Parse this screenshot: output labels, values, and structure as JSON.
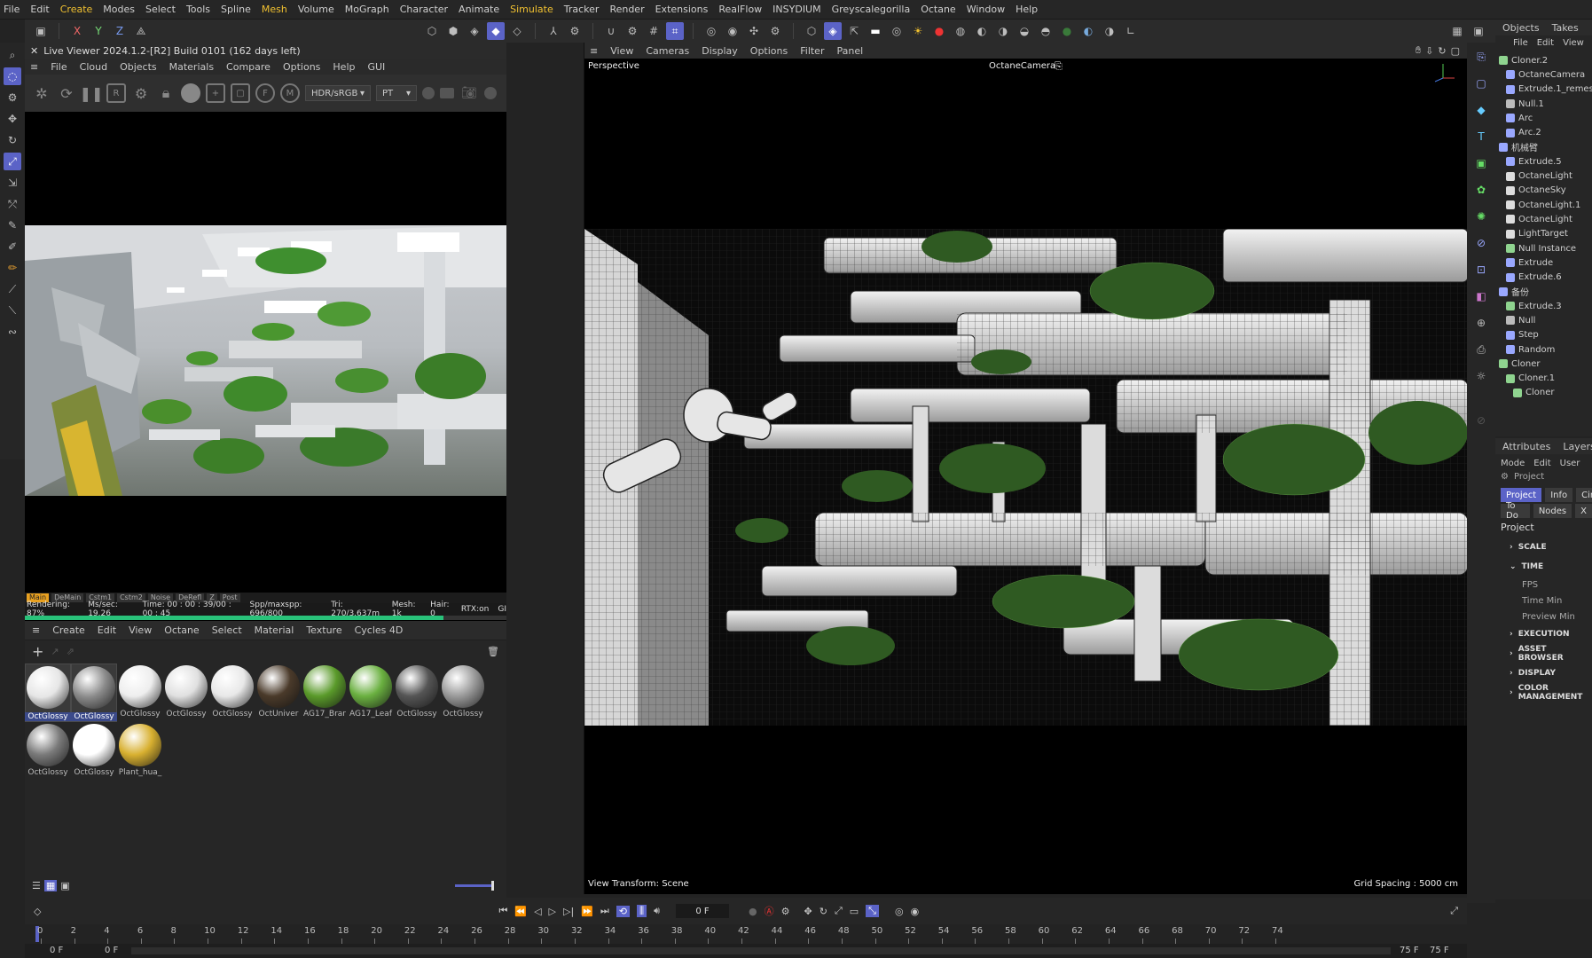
{
  "menubar": {
    "items": [
      "File",
      "Edit",
      "Create",
      "Modes",
      "Select",
      "Tools",
      "Spline",
      "Mesh",
      "Volume",
      "MoGraph",
      "Character",
      "Animate",
      "Simulate",
      "Tracker",
      "Render",
      "Extensions",
      "RealFlow",
      "INSYDIUM",
      "Greyscalegorilla",
      "Octane",
      "Window",
      "Help"
    ]
  },
  "toolbar": {
    "axes": [
      "X",
      "Y",
      "Z"
    ]
  },
  "live_viewer": {
    "title": "Live Viewer 2024.1.2-[R2] Build 0101 (162 days left)",
    "menu": [
      "File",
      "Cloud",
      "Objects",
      "Materials",
      "Compare",
      "Options",
      "Help",
      "GUI"
    ],
    "color_space": "HDR/sRGB",
    "kernel": "PT",
    "tabs": [
      "Main",
      "DeMain",
      "Cstm1",
      "Cstm2",
      "Noise",
      "DeRefl",
      "Z",
      "Post"
    ],
    "status": {
      "rendering": "Rendering: 87%",
      "mspersec": "Ms/sec: 19.26",
      "time": "Time: 00 : 00 : 39/00 : 00 : 45",
      "spp": "Spp/maxspp: 696/800",
      "tri": "Tri: 270/3.637m",
      "mesh": "Mesh: 1k",
      "hair": "Hair: 0",
      "rtx": "RTX:on",
      "gpu": "GI"
    },
    "progress": 0.87
  },
  "material_manager": {
    "menu": [
      "Create",
      "Edit",
      "View",
      "Octane",
      "Select",
      "Material",
      "Texture",
      "Cycles 4D"
    ],
    "materials": [
      {
        "name": "OctGlossy",
        "color": "#e6e6e6",
        "selected": true
      },
      {
        "name": "OctGlossy",
        "color": "#8a8a8a",
        "selected": true
      },
      {
        "name": "OctGlossy",
        "color": "#eeeeee",
        "selected": false
      },
      {
        "name": "OctGlossy",
        "color": "#e0e0e0",
        "selected": false
      },
      {
        "name": "OctGlossy",
        "color": "#e8e8e8",
        "selected": false
      },
      {
        "name": "OctUniver",
        "color": "#4a3a2a",
        "selected": false
      },
      {
        "name": "AG17_Brar",
        "color": "#5a9a2a",
        "selected": false
      },
      {
        "name": "AG17_Leaf",
        "color": "#6ab040",
        "selected": false
      },
      {
        "name": "OctGlossy",
        "color": "#555555",
        "selected": false
      },
      {
        "name": "OctGlossy",
        "color": "#9a9a9a",
        "selected": false
      },
      {
        "name": "OctGlossy",
        "color": "#7a7a7a",
        "selected": false
      },
      {
        "name": "OctGlossy",
        "color": "#ffffff",
        "selected": false
      },
      {
        "name": "Plant_hua_",
        "color": "#d8b030",
        "selected": false
      }
    ]
  },
  "viewport": {
    "menu": [
      "View",
      "Cameras",
      "Display",
      "Options",
      "Filter",
      "Panel"
    ],
    "view_name": "Perspective",
    "camera": "OctaneCamera",
    "view_transform": "View Transform: Scene",
    "grid_spacing": "Grid Spacing : 5000 cm"
  },
  "objects": {
    "tabs": [
      "Objects",
      "Takes"
    ],
    "menu": [
      "File",
      "Edit",
      "View"
    ],
    "items": [
      "Cloner.2",
      "OctaneCamera",
      "Extrude.1_remesh",
      "Null.1",
      "Arc",
      "Arc.2",
      "机械臂",
      "Extrude.5",
      "OctaneLight",
      "OctaneSky",
      "OctaneLight.1",
      "OctaneLight",
      "LightTarget",
      "Null Instance",
      "Extrude",
      "Extrude.6",
      "备份",
      "Extrude.3",
      "Null",
      "Step",
      "Random",
      "Cloner",
      "Cloner.1",
      "Cloner"
    ]
  },
  "attributes": {
    "tabs": [
      "Attributes",
      "Layers"
    ],
    "menu": [
      "Mode",
      "Edit",
      "User"
    ],
    "breadcrumb": "Project",
    "buttons1": [
      "Project",
      "Info",
      "Cin"
    ],
    "buttons2": [
      "To Do",
      "Nodes",
      "X"
    ],
    "heading": "Project",
    "sections": [
      {
        "label": "SCALE",
        "rows": []
      },
      {
        "label": "TIME",
        "rows": [
          "FPS",
          "Time Min",
          "Preview Min"
        ]
      },
      {
        "label": "EXECUTION",
        "rows": []
      },
      {
        "label": "ASSET BROWSER",
        "rows": []
      },
      {
        "label": "DISPLAY",
        "rows": []
      },
      {
        "label": "COLOR MANAGEMENT",
        "rows": []
      }
    ]
  },
  "timeline": {
    "current_frame": "0 F",
    "ticks": [
      "0",
      "2",
      "4",
      "6",
      "8",
      "10",
      "12",
      "14",
      "16",
      "18",
      "20",
      "22",
      "24",
      "26",
      "28",
      "30",
      "32",
      "34",
      "36",
      "38",
      "40",
      "42",
      "44",
      "46",
      "48",
      "50",
      "52",
      "54",
      "56",
      "58",
      "60",
      "62",
      "64",
      "66",
      "68",
      "70",
      "72",
      "74"
    ],
    "start": "0 F",
    "start2": "0 F",
    "end": "75 F",
    "end2": "75 F"
  }
}
